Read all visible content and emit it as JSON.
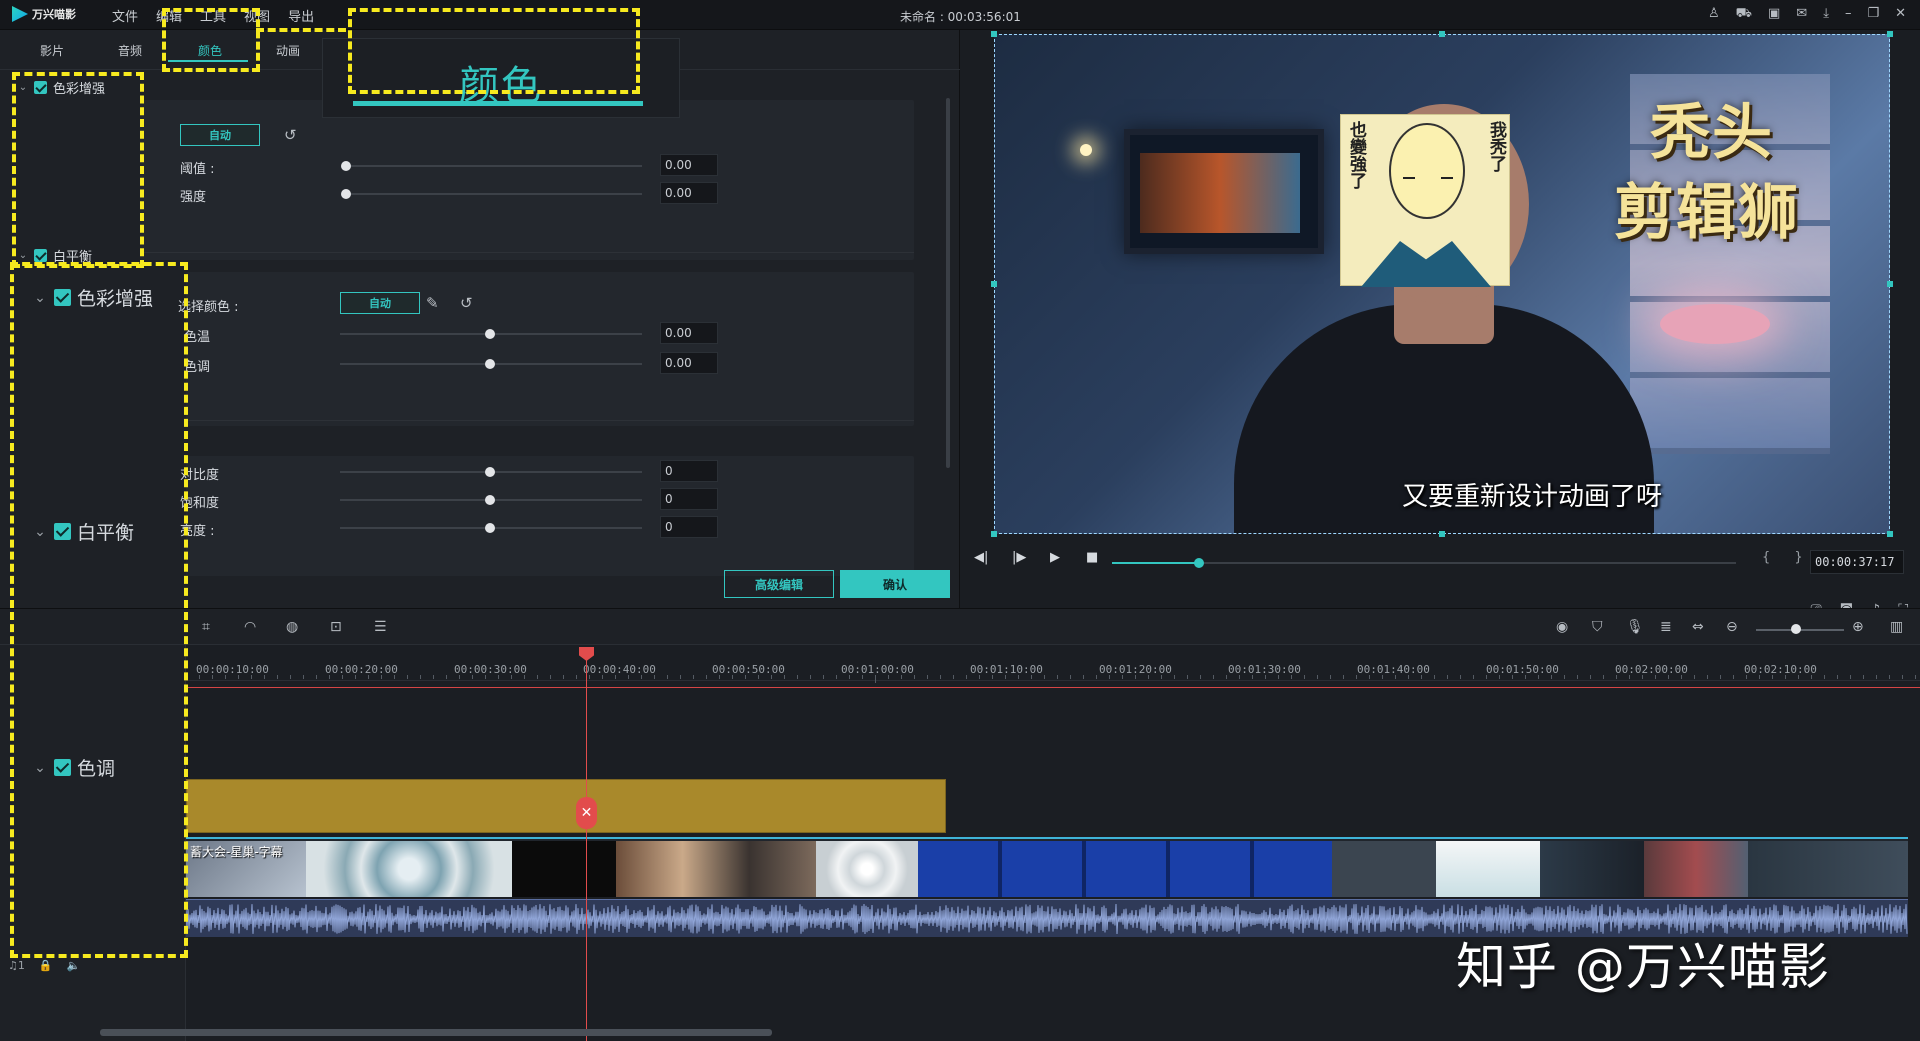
{
  "app": {
    "logo_text": "万兴喵影",
    "menu": [
      "文件",
      "编辑",
      "工具",
      "视图",
      "导出"
    ],
    "doc_title": "未命名 : 00:03:56:01"
  },
  "editor": {
    "tabs": [
      "影片",
      "音频",
      "颜色",
      "动画"
    ],
    "active_tab": "颜色",
    "callout_label": "颜色",
    "sections": {
      "color_enhance": "色彩增强",
      "white_balance": "白平衡",
      "tone": "色调"
    },
    "enhance": {
      "auto_label": "自动",
      "threshold_label": "阈值 :",
      "threshold_value": "0.00",
      "intensity_label": "强度",
      "intensity_value": "0.00"
    },
    "white_balance": {
      "select_color_label": "选择颜色 :",
      "auto_label": "自动",
      "temp_label": "色温",
      "temp_value": "0.00",
      "tint_label": "色调",
      "tint_value": "0.00"
    },
    "tone": {
      "contrast_label": "对比度",
      "contrast_value": "0",
      "saturation_label": "饱和度",
      "saturation_value": "0",
      "brightness_label": "亮度 :",
      "brightness_value": "0"
    },
    "advanced_label": "高级编辑",
    "confirm_label": "确认"
  },
  "preview": {
    "overlay_title_1": "秃头",
    "overlay_title_2": "剪辑狮",
    "subtitle": "又要重新设计动画了呀",
    "sticker_left": "也變強了",
    "sticker_right": "我秃了",
    "timecode": "00:00:37:17",
    "brackets": "{ }",
    "progress_fraction": 0.14
  },
  "timeline": {
    "ticks": [
      "00:00:10:00",
      "00:00:20:00",
      "00:00:30:00",
      "00:00:40:00",
      "00:00:50:00",
      "00:01:00:00",
      "00:01:10:00",
      "00:01:20:00",
      "00:01:30:00",
      "00:01:40:00",
      "00:01:50:00",
      "00:02:00:00",
      "00:02:10:00"
    ],
    "first_clip_label": "蓄大会-星巢-字幕",
    "track_label": "1",
    "zoom_fraction": 0.45
  },
  "watermark": "知乎 @万兴喵影",
  "colors": {
    "accent": "#33c6c0",
    "callout": "#f7ea1f",
    "playhead": "#e24c4c",
    "gold_clip": "#a9892b"
  }
}
